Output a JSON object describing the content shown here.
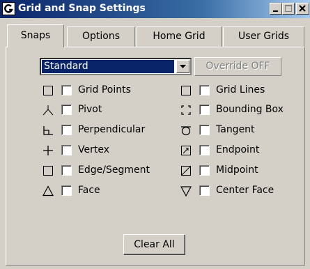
{
  "window": {
    "title": "Grid and Snap Settings",
    "controls": [
      "minimize-icon",
      "maximize-icon",
      "close-icon"
    ]
  },
  "tabs": [
    {
      "label": "Snaps",
      "active": true
    },
    {
      "label": "Options",
      "active": false
    },
    {
      "label": "Home Grid",
      "active": false
    },
    {
      "label": "User Grids",
      "active": false
    }
  ],
  "toolbar": {
    "dropdown_value": "Standard",
    "override_label": "Override OFF"
  },
  "snaps": [
    {
      "label": "Grid Points",
      "icon": "grid-points-icon",
      "checked": false
    },
    {
      "label": "Grid Lines",
      "icon": "grid-lines-icon",
      "checked": false
    },
    {
      "label": "Pivot",
      "icon": "pivot-icon",
      "checked": false
    },
    {
      "label": "Bounding Box",
      "icon": "bounding-box-icon",
      "checked": false
    },
    {
      "label": "Perpendicular",
      "icon": "perpendicular-icon",
      "checked": false
    },
    {
      "label": "Tangent",
      "icon": "tangent-icon",
      "checked": false
    },
    {
      "label": "Vertex",
      "icon": "vertex-icon",
      "checked": false
    },
    {
      "label": "Endpoint",
      "icon": "endpoint-icon",
      "checked": false
    },
    {
      "label": "Edge/Segment",
      "icon": "edge-segment-icon",
      "checked": false
    },
    {
      "label": "Midpoint",
      "icon": "midpoint-icon",
      "checked": false
    },
    {
      "label": "Face",
      "icon": "face-icon",
      "checked": false
    },
    {
      "label": "Center Face",
      "icon": "center-face-icon",
      "checked": false
    }
  ],
  "footer": {
    "clear_label": "Clear All"
  },
  "colors": {
    "title_start": "#0a246a",
    "title_end": "#a6caf0",
    "face": "#d4d0c8",
    "selection": "#0a246a"
  }
}
